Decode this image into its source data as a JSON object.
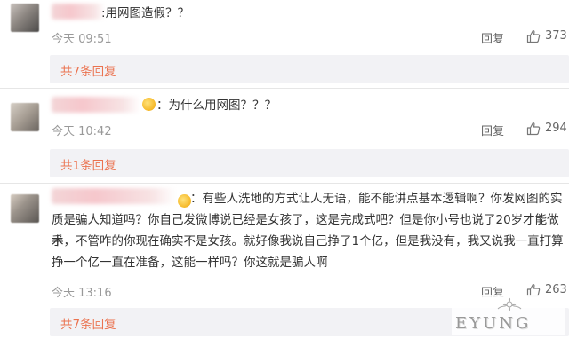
{
  "comments": [
    {
      "text": "用网图造假？？",
      "time": "今天 09:51",
      "reply_label": "回复",
      "likes": "373",
      "sub_replies": "共7条回复"
    },
    {
      "text": "为什么用网图？？？",
      "time": "今天 10:42",
      "reply_label": "回复",
      "likes": "294",
      "sub_replies": "共1条回复"
    },
    {
      "text_lines": [
        "：有些人洗地的方式让人无语，能不能讲点基本逻辑啊？你发网图的实",
        "质是骗人知道吗？你自己发微博说已经是女孩了，这是完成式吧？但是你小号也说了20岁才能做手",
        "术，不管咋的你现在确实不是女孩。就好像我说自己挣了1个亿，但是我没有，我又说我一直打算",
        "挣一个亿一直在准备，这能一样吗？你这就是骗人啊"
      ],
      "time": "今天 13:16",
      "reply_label": "回复",
      "likes": "263",
      "sub_replies": "共7条回复"
    }
  ],
  "icons": [
    "thumbs-up-icon",
    "emoji-icon",
    "flower-icon"
  ],
  "watermark": "EYUNG",
  "colors": {
    "link_orange": "#eb7350",
    "meta_gray": "#999999",
    "sub_reply_bg": "#f2f2f5"
  }
}
